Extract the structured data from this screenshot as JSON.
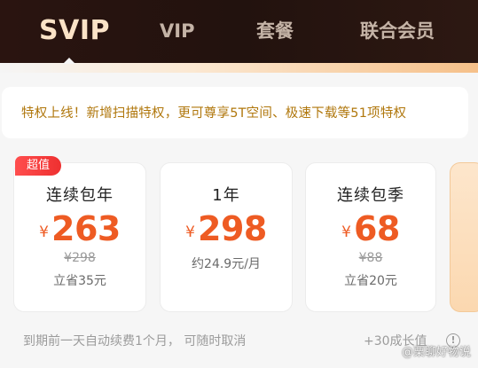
{
  "tabs": {
    "svip": "SVIP",
    "vip": "VIP",
    "package": "套餐",
    "joint": "联合会员"
  },
  "banner": {
    "text": "特权上线！新增扫描特权，更可尊享5T空间、极速下载等51项特权"
  },
  "plans": [
    {
      "badge": "超值",
      "title": "连续包年",
      "currency": "¥",
      "price": "263",
      "original_price": "¥298",
      "note": "立省35元"
    },
    {
      "title": "1年",
      "currency": "¥",
      "price": "298",
      "note": "约24.9元/月"
    },
    {
      "title": "连续包季",
      "currency": "¥",
      "price": "68",
      "original_price": "¥88",
      "note": "立省20元"
    }
  ],
  "footer": {
    "renewal_notice": "到期前一天自动续费1个月， 可随时取消",
    "growth": "+30成长值",
    "info_icon_glyph": "!"
  },
  "watermark": "@栗聊好物说",
  "colors": {
    "header_bg": "#22120e",
    "active_tab": "#fbe3c7",
    "price": "#ee5b23",
    "banner_text": "#b0770c",
    "badge": "#ee3030"
  }
}
